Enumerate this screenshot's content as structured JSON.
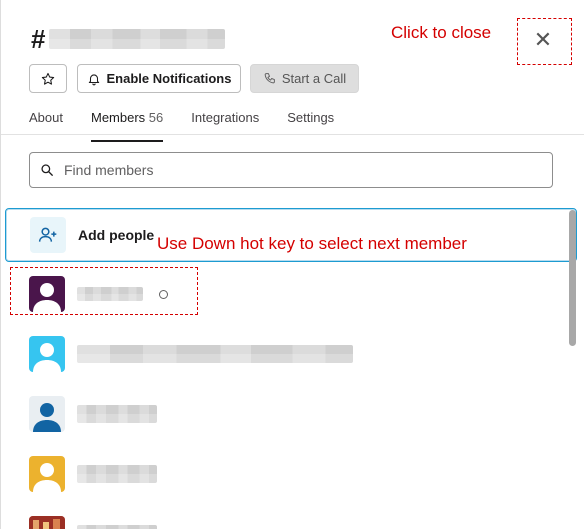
{
  "header": {
    "hash": "#",
    "channel_name": "",
    "close_icon": "close-icon",
    "close_glyph": "✕"
  },
  "annotations": {
    "close_hint": "Click to close",
    "down_hint": "Use Down hot key to select next member",
    "color": "#d40000"
  },
  "actions": {
    "star_icon": "star-icon",
    "notifications_label": "Enable Notifications",
    "notifications_icon": "bell-icon",
    "call_label": "Start a Call",
    "call_icon": "phone-icon"
  },
  "tabs": [
    {
      "label": "About"
    },
    {
      "label": "Members",
      "count": "56",
      "active": true
    },
    {
      "label": "Integrations"
    },
    {
      "label": "Settings"
    }
  ],
  "search": {
    "placeholder": "Find members",
    "value": "",
    "icon": "search-icon"
  },
  "members_list": {
    "add_people_label": "Add people",
    "add_people_icon": "add-person-icon",
    "members": [
      {
        "name": "",
        "avatar_color": "#4a154b",
        "status": "away"
      },
      {
        "name": "",
        "avatar_color": "#36c5f0"
      },
      {
        "name": "",
        "avatar_color": "#1264a3"
      },
      {
        "name": "",
        "avatar_color": "#ecb22e"
      },
      {
        "name": "",
        "avatar_color": "#c94b3a"
      }
    ]
  },
  "colors": {
    "accent_focus": "#1d9bd1",
    "text_primary": "#1d1c1d"
  }
}
